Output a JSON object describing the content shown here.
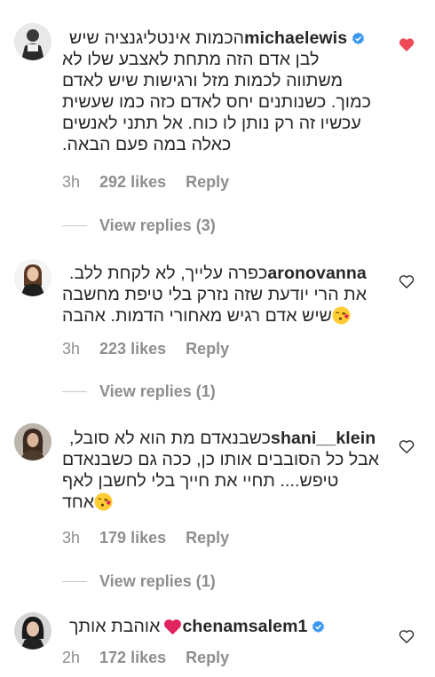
{
  "comments": [
    {
      "username": "michaelewis",
      "verified": true,
      "first_text": "הכמות אינטליגנציה שיש",
      "lines": [
        "לבן אדם הזה מתחת לאצבע שלו לא",
        "משתווה לכמות מזל ורגישות שיש לאדם",
        "כמוך. כשנותנים יחס לאדם כזה כמו שעשית",
        "עכשיו זה רק נותן לו כוח. אל תתני לאנשים",
        "כאלה במה פעם הבאה."
      ],
      "time": "3h",
      "likes": "292 likes",
      "reply": "Reply",
      "liked": true,
      "view_replies": "View replies (3)"
    },
    {
      "username": "aronovanna",
      "verified": false,
      "first_text": "כפרה עלייך, לא לקחת ללב.",
      "lines": [
        "את הרי יודעת שזה נזרק בלי טיפת מחשבה",
        "שיש אדם רגיש מאחורי הדמות. אהבה"
      ],
      "time": "3h",
      "likes": "223 likes",
      "reply": "Reply",
      "liked": false,
      "view_replies": "View replies (1)"
    },
    {
      "username": "shani__klein",
      "verified": false,
      "first_text": "כשבנאדם מת הוא לא סובל,",
      "lines": [
        "אבל כל הסובבים אותו כן, ככה גם כשבנאדם",
        "טיפש.... תחיי את חייך בלי לחשבן לאף",
        "אחד"
      ],
      "time": "3h",
      "likes": "179 likes",
      "reply": "Reply",
      "liked": false,
      "view_replies": "View replies (1)"
    },
    {
      "username": "chenamsalem1",
      "verified": true,
      "first_text": "אוהבת אותך",
      "lines": [],
      "time": "2h",
      "likes": "172 likes",
      "reply": "Reply",
      "liked": false
    }
  ],
  "colors": {
    "text": "#262626",
    "muted": "#8e8e8e",
    "verified": "#3897f0",
    "liked_heart": "#ed4956"
  },
  "icons": {
    "verified": "verified-badge-icon",
    "heart": "heart-icon",
    "emoji_kiss": "face-blowing-kiss-emoji",
    "emoji_heart": "red-heart-emoji"
  }
}
